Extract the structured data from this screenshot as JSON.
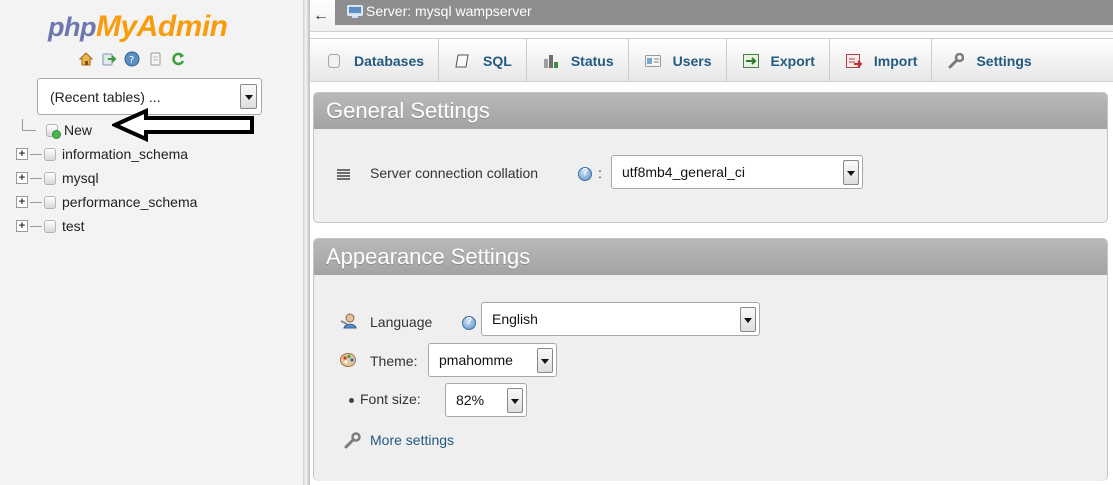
{
  "logo": {
    "part1": "php",
    "part2": "MyAdmin"
  },
  "nav": {
    "icons": [
      "home-icon",
      "exit-icon",
      "query-window-icon",
      "documentation-icon",
      "reload-icon"
    ],
    "recent_tables": "(Recent tables) ...",
    "tree": [
      {
        "label": "New",
        "kind": "new"
      },
      {
        "label": "information_schema",
        "kind": "db"
      },
      {
        "label": "mysql",
        "kind": "db"
      },
      {
        "label": "performance_schema",
        "kind": "db"
      },
      {
        "label": "test",
        "kind": "db"
      }
    ]
  },
  "topbar": {
    "back_glyph": "←",
    "server_label": "Server: mysql wampserver"
  },
  "tabs": [
    {
      "label": "Databases",
      "icon": "databases-icon"
    },
    {
      "label": "SQL",
      "icon": "sql-icon"
    },
    {
      "label": "Status",
      "icon": "status-icon"
    },
    {
      "label": "Users",
      "icon": "users-icon"
    },
    {
      "label": "Export",
      "icon": "export-icon"
    },
    {
      "label": "Import",
      "icon": "import-icon"
    },
    {
      "label": "Settings",
      "icon": "settings-icon"
    }
  ],
  "general": {
    "title": "General Settings",
    "collation_label": "Server connection collation",
    "colon": ":",
    "collation_value": "utf8mb4_general_ci"
  },
  "appearance": {
    "title": "Appearance Settings",
    "language_label": "Language",
    "colon": ":",
    "language_value": "English",
    "theme_label": "Theme:",
    "theme_value": "pmahomme",
    "font_size_label": "Font size:",
    "font_size_value": "82%",
    "more_settings": "More settings"
  },
  "colors": {
    "logo_php": "#6c78af",
    "logo_myadmin": "#f89c0e",
    "link": "#235a81",
    "panel_header": "#a8a8a8",
    "server_bar": "#8d8d8d"
  }
}
